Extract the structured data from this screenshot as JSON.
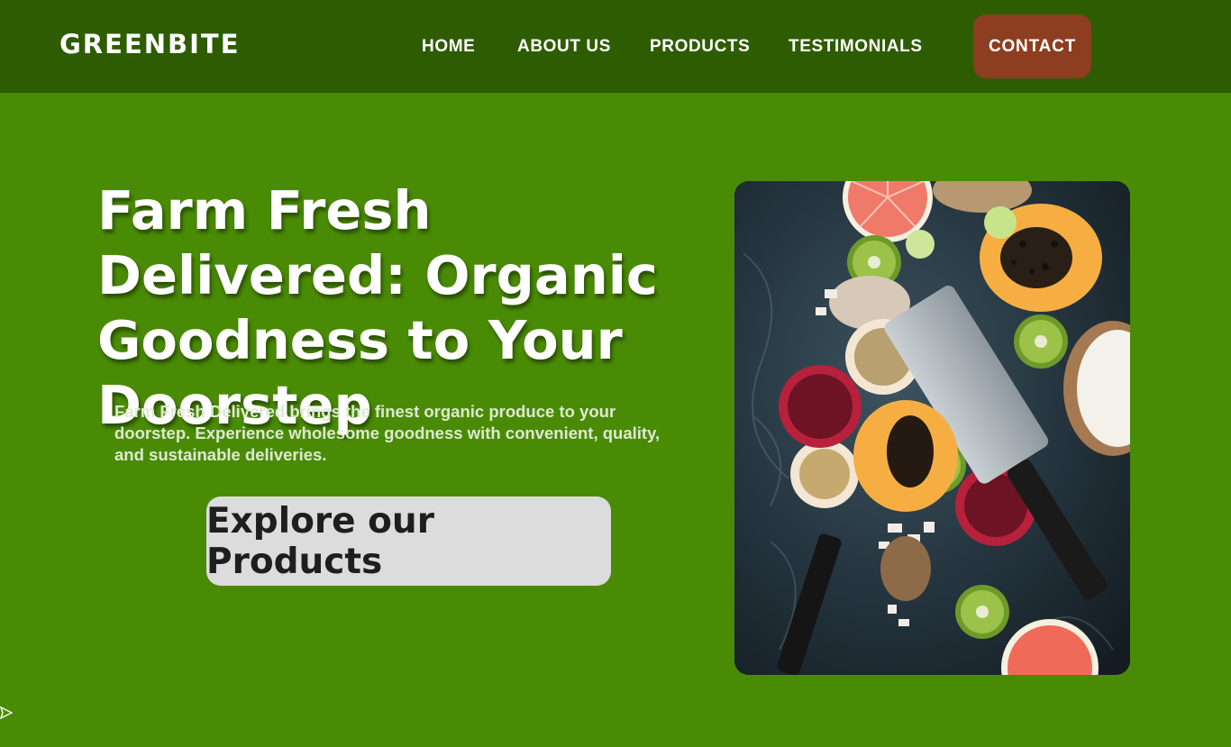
{
  "header": {
    "brand": "GREENBITE",
    "nav": [
      {
        "label": "HOME"
      },
      {
        "label": "ABOUT US"
      },
      {
        "label": "PRODUCTS"
      },
      {
        "label": "TESTIMONIALS"
      }
    ],
    "contact_label": "CONTACT"
  },
  "hero": {
    "headline": "Farm Fresh Delivered: Organic Goodness to Your Doorstep",
    "description": "Farm Fresh Delivered brings the finest organic produce to your doorstep. Experience wholesome goodness with convenient, quality, and sustainable deliveries.",
    "cta_label": "Explore our Products",
    "image_icon": "fruit-photo-icon"
  },
  "colors": {
    "page_bg": "#4a8b06",
    "header_bg": "#2e5c02",
    "contact_bg": "#8e3e20",
    "cta_bg": "#dcdcdc"
  }
}
